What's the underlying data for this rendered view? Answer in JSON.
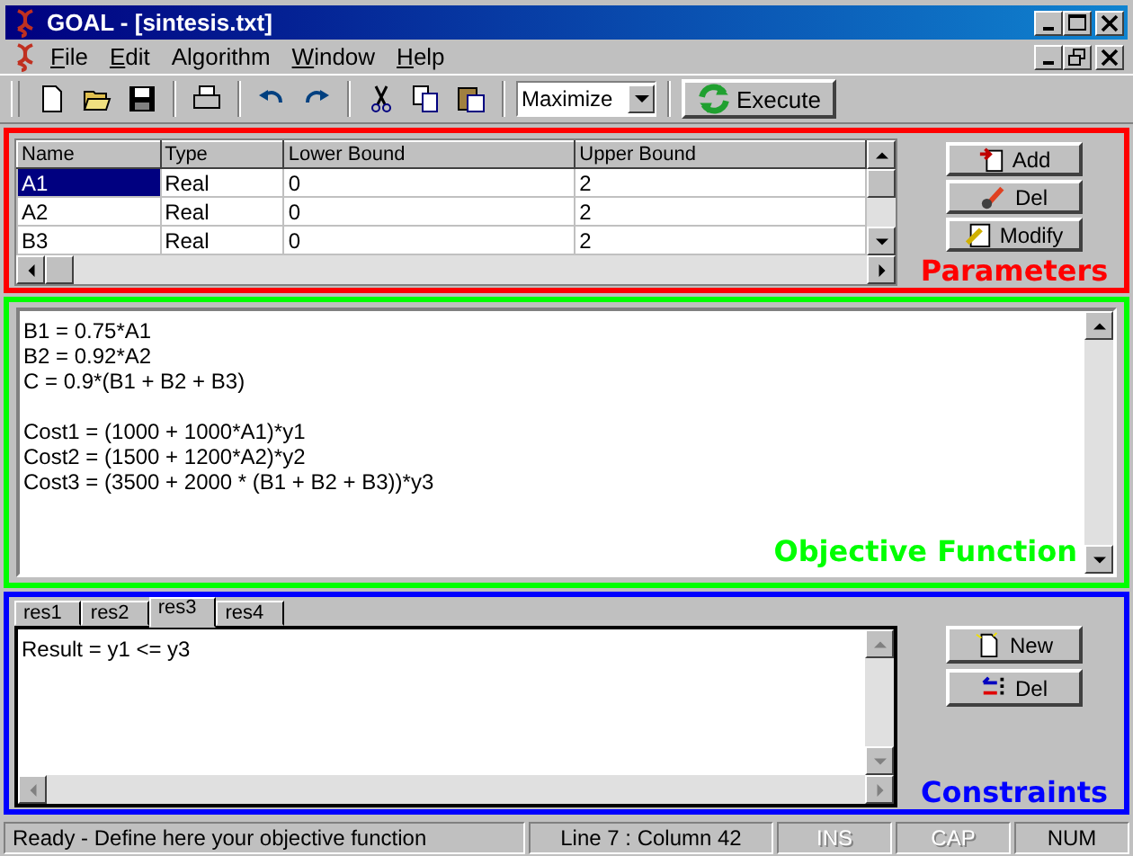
{
  "window": {
    "title": "GOAL - [sintesis.txt]"
  },
  "menu": [
    {
      "label": "File",
      "underline_first": true
    },
    {
      "label": "Edit",
      "underline_first": true
    },
    {
      "label": "Algorithm",
      "underline_first": false
    },
    {
      "label": "Window",
      "underline_first": true
    },
    {
      "label": "Help",
      "underline_first": true
    }
  ],
  "toolbar": {
    "mode": "Maximize",
    "execute": "Execute"
  },
  "parameters": {
    "columns": [
      "Name",
      "Type",
      "Lower Bound",
      "Upper Bound"
    ],
    "rows": [
      {
        "cells": [
          "A1",
          "Real",
          "0",
          "2"
        ],
        "selected": true
      },
      {
        "cells": [
          "A2",
          "Real",
          "0",
          "2"
        ],
        "selected": false
      },
      {
        "cells": [
          "B3",
          "Real",
          "0",
          "2"
        ],
        "selected": false
      }
    ],
    "buttons": [
      "Add",
      "Del",
      "Modify"
    ],
    "annotation": "Parameters"
  },
  "objective": {
    "paragraphs": [
      [
        "B1 = 0.75*A1",
        "B2 = 0.92*A2",
        "C = 0.9*(B1 + B2 + B3)"
      ],
      [
        "Cost1 = (1000 + 1000*A1)*y1",
        "Cost2 = (1500 + 1200*A2)*y2",
        "Cost3 = (3500 + 2000 * (B1 + B2 + B3))*y3"
      ]
    ],
    "annotation": "Objective Function"
  },
  "constraints": {
    "tabs": [
      {
        "label": "res1",
        "selected": false
      },
      {
        "label": "res2",
        "selected": false
      },
      {
        "label": "res3",
        "selected": true
      },
      {
        "label": "res4",
        "selected": false
      }
    ],
    "text": "Result = y1 <= y3",
    "buttons": [
      "New",
      "Del"
    ],
    "annotation": "Constraints"
  },
  "status_bar": {
    "message": "Ready - Define here your objective function",
    "position": "Line 7 : Column 42",
    "indicators": [
      {
        "label": "INS",
        "on": false
      },
      {
        "label": "CAP",
        "on": false
      },
      {
        "label": "NUM",
        "on": true
      }
    ]
  }
}
